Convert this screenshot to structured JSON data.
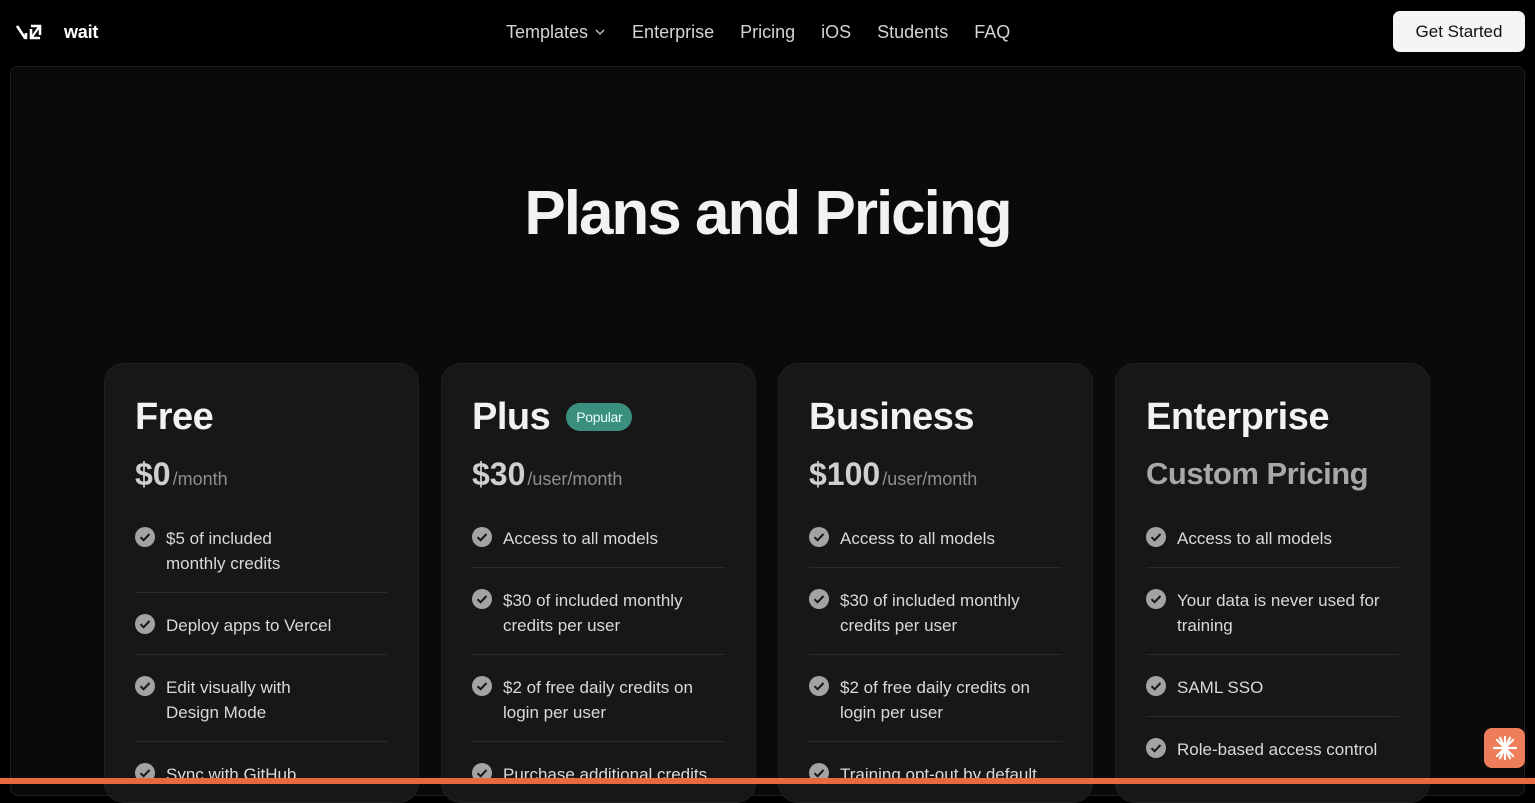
{
  "brand": {
    "name": "wait"
  },
  "nav": {
    "items": [
      {
        "label": "Templates",
        "has_dropdown": true
      },
      {
        "label": "Enterprise"
      },
      {
        "label": "Pricing"
      },
      {
        "label": "iOS"
      },
      {
        "label": "Students"
      },
      {
        "label": "FAQ"
      }
    ],
    "cta_label": "Get Started"
  },
  "page": {
    "title": "Plans and Pricing"
  },
  "plans": [
    {
      "name": "Free",
      "price": "$0",
      "period": "/month",
      "features": [
        "$5 of included monthly credits",
        "Deploy apps to Vercel",
        "Edit visually with Design Mode",
        "Sync with GitHub"
      ]
    },
    {
      "name": "Plus",
      "badge": "Popular",
      "price": "$30",
      "period": "/user/month",
      "features": [
        "Access to all models",
        "$30 of included monthly credits per user",
        "$2 of free daily credits on login per user",
        "Purchase additional credits"
      ]
    },
    {
      "name": "Business",
      "price": "$100",
      "period": "/user/month",
      "features": [
        "Access to all models",
        "$30 of included monthly credits per user",
        "$2 of free daily credits on login per user",
        "Training opt-out by default"
      ]
    },
    {
      "name": "Enterprise",
      "price_text": "Custom Pricing",
      "features": [
        "Access to all models",
        "Your data is never used for training",
        "SAML SSO",
        "Role-based access control"
      ]
    }
  ],
  "colors": {
    "background": "#000000",
    "panel": "#0a0a0a",
    "card": "#171717",
    "badge": "#3a8f7e",
    "accent_bar": "#e56b3f",
    "help_button": "#ee7d59"
  },
  "icons": {
    "logo": "v0-logo-icon",
    "dropdown": "chevron-down-icon",
    "feature": "check-circle-icon",
    "help": "sparkle-icon"
  }
}
